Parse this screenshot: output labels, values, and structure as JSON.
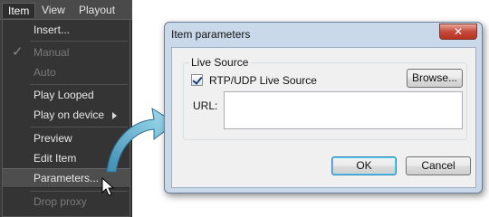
{
  "menubar": {
    "items": [
      {
        "label": "Item"
      },
      {
        "label": "View"
      },
      {
        "label": "Playout"
      }
    ]
  },
  "menu": {
    "insert": "Insert...",
    "manual": "Manual",
    "auto": "Auto",
    "play_looped": "Play Looped",
    "play_on_device": "Play on device",
    "preview": "Preview",
    "edit_item": "Edit Item",
    "parameters": "Parameters...",
    "drop_proxy": "Drop proxy",
    "check_glyph": "✓"
  },
  "dialog": {
    "title": "Item parameters",
    "close_glyph": "✕",
    "group_title": "Live Source",
    "checkbox_label": "RTP/UDP Live Source",
    "checkbox_checked": true,
    "browse_label": "Browse...",
    "url_label": "URL:",
    "url_value": "",
    "ok_label": "OK",
    "cancel_label": "Cancel"
  },
  "colors": {
    "menu_bg": "#343434",
    "dialog_frame": "#c9d9ea",
    "arrow": "#5fb6d6"
  }
}
